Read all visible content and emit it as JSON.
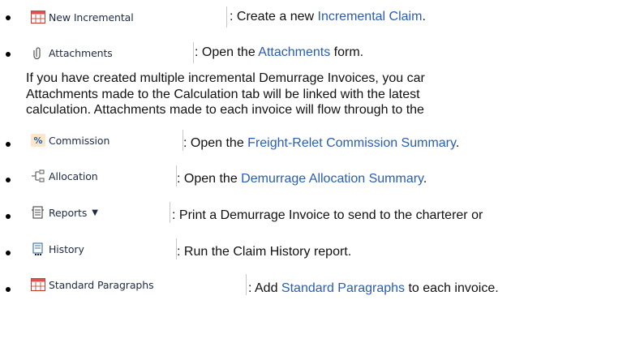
{
  "items": [
    {
      "button": "New Incremental",
      "icon": "calendar-grid-icon",
      "pre": ": Create a new ",
      "link": "Incremental Claim",
      "post": "."
    },
    {
      "button": "Attachments",
      "icon": "paperclip-icon",
      "pre": ": Open the ",
      "link": "Attachments",
      "post": " form."
    },
    {
      "button": "Commission",
      "icon": "percent-icon",
      "pre": ": Open the ",
      "link": "Freight-Relet Commission Summary",
      "post": "."
    },
    {
      "button": "Allocation",
      "icon": "allocation-icon",
      "pre": ": Open the ",
      "link": "Demurrage Allocation Summary",
      "post": "."
    },
    {
      "button": "Reports",
      "icon": "report-icon",
      "pre": ": Print a Demurrage Invoice to send to the charterer or",
      "link": "",
      "post": ""
    },
    {
      "button": "History",
      "icon": "history-icon",
      "pre": ": Run the Claim History report.",
      "link": "",
      "post": ""
    },
    {
      "button": "Standard Paragraphs",
      "icon": "paragraph-grid-icon",
      "pre": ": Add ",
      "link": "Standard Paragraphs",
      "post": " to each invoice."
    }
  ],
  "note": {
    "line1": "If you have created multiple incremental Demurrage Invoices, you car",
    "line2": "Attachments made to the Calculation tab will be linked with the latest",
    "line3": "calculation. Attachments made to each invoice will flow through to the"
  },
  "colors": {
    "link": "#2a5db0",
    "button_text": "#1d2a43"
  }
}
